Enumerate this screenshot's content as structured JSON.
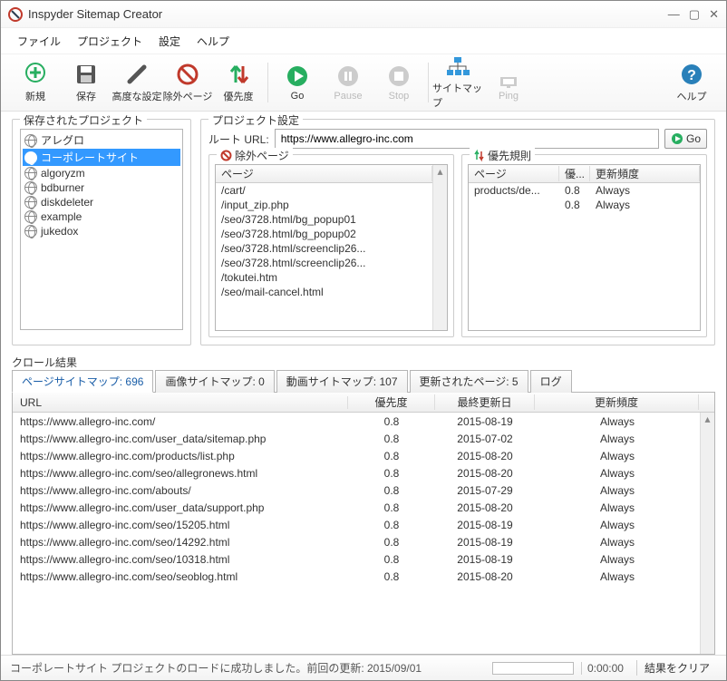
{
  "window": {
    "title": "Inspyder Sitemap Creator"
  },
  "menu": {
    "file": "ファイル",
    "project": "プロジェクト",
    "settings": "設定",
    "help": "ヘルプ"
  },
  "toolbar": {
    "new": "新規",
    "save": "保存",
    "adv": "高度な設定",
    "excl": "除外ページ",
    "prio": "優先度",
    "go": "Go",
    "pause": "Pause",
    "stop": "Stop",
    "sitemap": "サイトマップ",
    "ping": "Ping",
    "help": "ヘルプ"
  },
  "groups": {
    "saved": "保存されたプロジェクト",
    "proj": "プロジェクト設定",
    "root": "ルート URL:",
    "excl": "除外ページ",
    "prio": "優先規則",
    "crawl": "クロール結果"
  },
  "rootUrl": "https://www.allegro-inc.com",
  "goBtn": "Go",
  "tree": [
    {
      "label": "アレグロ",
      "selected": false
    },
    {
      "label": "コーポレートサイト",
      "selected": true
    },
    {
      "label": "algoryzm",
      "selected": false
    },
    {
      "label": "bdburner",
      "selected": false
    },
    {
      "label": "diskdeleter",
      "selected": false
    },
    {
      "label": "example",
      "selected": false
    },
    {
      "label": "jukedox",
      "selected": false
    }
  ],
  "exclHd": "ページ",
  "exclRows": [
    "/cart/",
    "/input_zip.php",
    "/seo/3728.html/bg_popup01",
    "/seo/3728.html/bg_popup02",
    "/seo/3728.html/screenclip26...",
    "/seo/3728.html/screenclip26...",
    "/tokutei.htm",
    "/seo/mail-cancel.html"
  ],
  "prioHd": {
    "page": "ページ",
    "pri": "優...",
    "freq": "更新頻度"
  },
  "prioRows": [
    {
      "page": "products/de...",
      "pri": "0.8",
      "freq": "Always"
    },
    {
      "page": "",
      "pri": "0.8",
      "freq": "Always"
    }
  ],
  "tabs": [
    {
      "label": "ページサイトマップ: 696",
      "active": true
    },
    {
      "label": "画像サイトマップ: 0",
      "active": false
    },
    {
      "label": "動画サイトマップ: 107",
      "active": false
    },
    {
      "label": "更新されたページ: 5",
      "active": false
    },
    {
      "label": "ログ",
      "active": false
    }
  ],
  "tableHd": {
    "url": "URL",
    "pri": "優先度",
    "mod": "最終更新日",
    "freq": "更新頻度"
  },
  "tableRows": [
    {
      "url": "https://www.allegro-inc.com/",
      "pri": "0.8",
      "mod": "2015-08-19",
      "freq": "Always"
    },
    {
      "url": "https://www.allegro-inc.com/user_data/sitemap.php",
      "pri": "0.8",
      "mod": "2015-07-02",
      "freq": "Always"
    },
    {
      "url": "https://www.allegro-inc.com/products/list.php",
      "pri": "0.8",
      "mod": "2015-08-20",
      "freq": "Always"
    },
    {
      "url": "https://www.allegro-inc.com/seo/allegronews.html",
      "pri": "0.8",
      "mod": "2015-08-20",
      "freq": "Always"
    },
    {
      "url": "https://www.allegro-inc.com/abouts/",
      "pri": "0.8",
      "mod": "2015-07-29",
      "freq": "Always"
    },
    {
      "url": "https://www.allegro-inc.com/user_data/support.php",
      "pri": "0.8",
      "mod": "2015-08-20",
      "freq": "Always"
    },
    {
      "url": "https://www.allegro-inc.com/seo/15205.html",
      "pri": "0.8",
      "mod": "2015-08-19",
      "freq": "Always"
    },
    {
      "url": "https://www.allegro-inc.com/seo/14292.html",
      "pri": "0.8",
      "mod": "2015-08-19",
      "freq": "Always"
    },
    {
      "url": "https://www.allegro-inc.com/seo/10318.html",
      "pri": "0.8",
      "mod": "2015-08-19",
      "freq": "Always"
    },
    {
      "url": "https://www.allegro-inc.com/seo/seoblog.html",
      "pri": "0.8",
      "mod": "2015-08-20",
      "freq": "Always"
    }
  ],
  "status": {
    "msg": "コーポレートサイト プロジェクトのロードに成功しました。前回の更新: 2015/09/01",
    "time": "0:00:00",
    "clear": "結果をクリア"
  }
}
